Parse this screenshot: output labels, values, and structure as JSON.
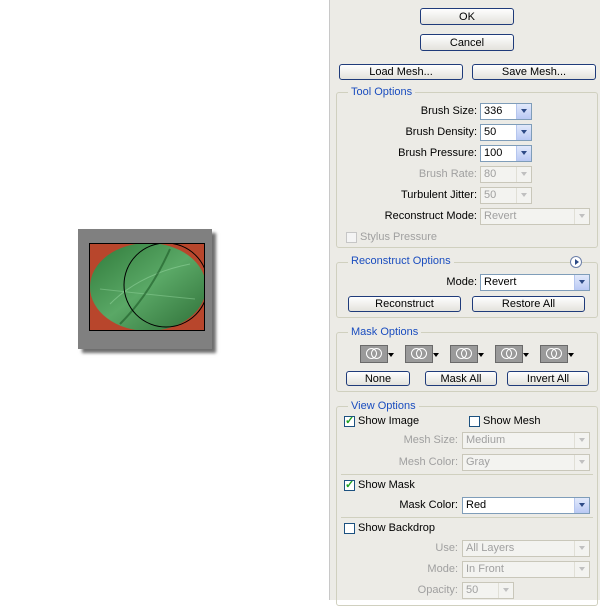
{
  "buttons": {
    "ok": "OK",
    "cancel": "Cancel",
    "load_mesh": "Load Mesh...",
    "save_mesh": "Save Mesh..."
  },
  "tool_options": {
    "title": "Tool Options",
    "brush_size": {
      "label": "Brush Size:",
      "value": "336"
    },
    "brush_density": {
      "label": "Brush Density:",
      "value": "50"
    },
    "brush_pressure": {
      "label": "Brush Pressure:",
      "value": "100"
    },
    "brush_rate": {
      "label": "Brush Rate:",
      "value": "80"
    },
    "turbulent_jitter": {
      "label": "Turbulent Jitter:",
      "value": "50"
    },
    "reconstruct_mode": {
      "label": "Reconstruct Mode:",
      "value": "Revert"
    },
    "stylus_pressure": "Stylus Pressure"
  },
  "reconstruct_options": {
    "title": "Reconstruct Options",
    "mode_label": "Mode:",
    "mode_value": "Revert",
    "reconstruct": "Reconstruct",
    "restore_all": "Restore All"
  },
  "mask_options": {
    "title": "Mask Options",
    "modes": [
      "replace-selection-icon",
      "add-to-selection-icon",
      "subtract-from-selection-icon",
      "intersect-with-selection-icon",
      "invert-selection-icon"
    ],
    "none": "None",
    "mask_all": "Mask All",
    "invert_all": "Invert All"
  },
  "view_options": {
    "title": "View Options",
    "show_image": "Show Image",
    "show_image_checked": true,
    "show_mesh": "Show Mesh",
    "show_mesh_checked": false,
    "mesh_size": {
      "label": "Mesh Size:",
      "value": "Medium"
    },
    "mesh_color": {
      "label": "Mesh Color:",
      "value": "Gray"
    },
    "show_mask": "Show Mask",
    "show_mask_checked": true,
    "mask_color": {
      "label": "Mask Color:",
      "value": "Red"
    },
    "show_backdrop": "Show Backdrop",
    "show_backdrop_checked": false,
    "use": {
      "label": "Use:",
      "value": "All Layers"
    },
    "mode": {
      "label": "Mode:",
      "value": "In Front"
    },
    "opacity": {
      "label": "Opacity:",
      "value": "50"
    }
  },
  "colors": {
    "accent": "#1a4dbf",
    "mask": "#b8462c",
    "image": "#3e8a4a",
    "panel": "#ecebe6"
  }
}
